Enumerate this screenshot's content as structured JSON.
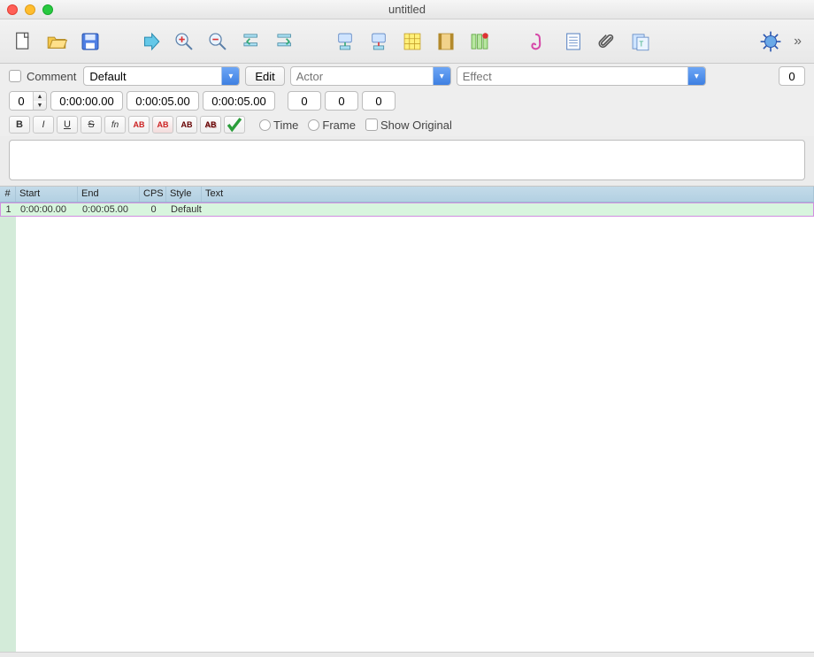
{
  "window": {
    "title": "untitled"
  },
  "row2": {
    "comment_label": "Comment",
    "style_value": "Default",
    "edit_label": "Edit",
    "actor_placeholder": "Actor",
    "effect_placeholder": "Effect",
    "count": "0"
  },
  "row3": {
    "layer": "0",
    "start": "0:00:00.00",
    "end": "0:00:05.00",
    "duration": "0:00:05.00",
    "margin_l": "0",
    "margin_r": "0",
    "margin_v": "0"
  },
  "row4": {
    "b": "B",
    "i": "I",
    "u": "U",
    "s": "S",
    "fn": "fn",
    "ab1": "AB",
    "ab2": "AB",
    "ab3": "AB",
    "ab4": "AB",
    "time_label": "Time",
    "frame_label": "Frame",
    "show_original_label": "Show Original"
  },
  "grid": {
    "headers": {
      "num": "#",
      "start": "Start",
      "end": "End",
      "cps": "CPS",
      "style": "Style",
      "text": "Text"
    },
    "rows": [
      {
        "num": "1",
        "start": "0:00:00.00",
        "end": "0:00:05.00",
        "cps": "0",
        "style": "Default",
        "text": ""
      }
    ]
  },
  "icons": {
    "new": "new-file-icon",
    "open": "open-folder-icon",
    "save": "save-icon",
    "arrow": "forward-arrow-icon",
    "zoom_in": "zoom-in-icon",
    "zoom_out": "zoom-out-icon",
    "jump_start": "jump-start-icon",
    "jump_sel": "jump-selection-icon",
    "shift_frame1": "shift-video-icon",
    "shift_frame2": "shift-video2-icon",
    "grid_tool": "spreadsheet-icon",
    "film": "film-icon",
    "columns": "columns-icon",
    "style_mgr": "style-manager-icon",
    "notes": "notes-icon",
    "attach": "attachment-icon",
    "copy": "copy-icon",
    "script": "script-gear-icon"
  }
}
